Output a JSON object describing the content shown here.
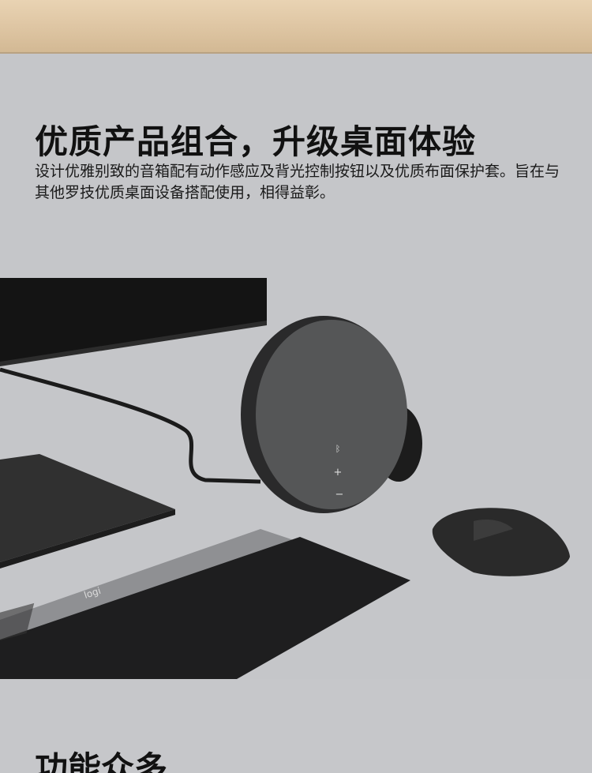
{
  "hero": {
    "title": "优质产品组合，升级桌面体验",
    "description": "设计优雅别致的音箱配有动作感应及背光控制按钮以及优质布面保护套。旨在与其他罗技优质桌面设备搭配使用，相得益彰。"
  },
  "scene": {
    "keyboard_logo": "logi"
  },
  "section2": {
    "title": "功能众多"
  },
  "colors": {
    "background": "#c5c6c9",
    "text": "#111111"
  }
}
